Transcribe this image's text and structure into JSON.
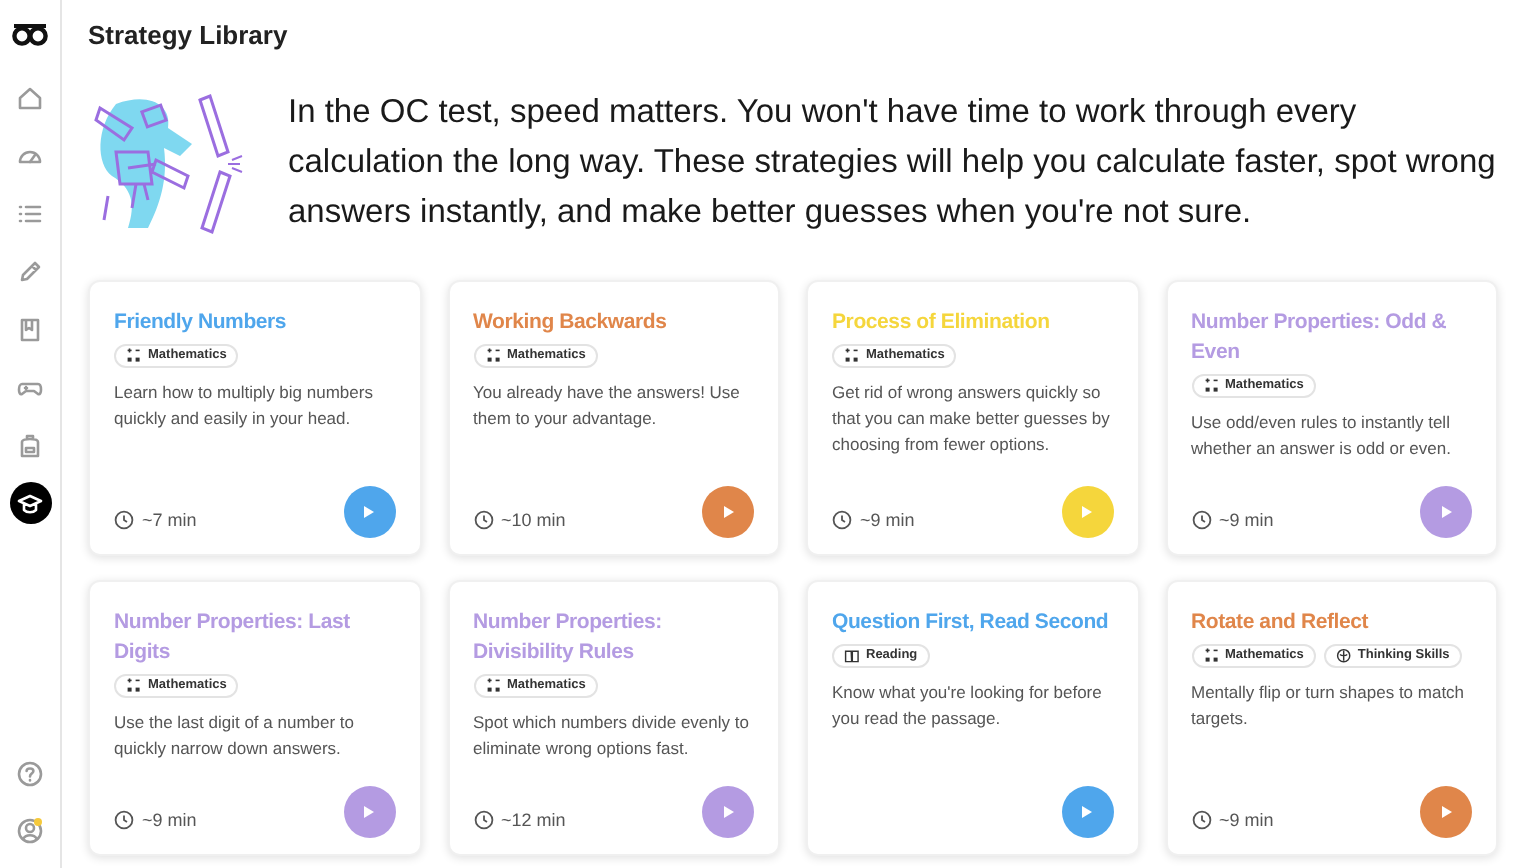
{
  "header": {
    "title": "Strategy Library"
  },
  "sidebar": {
    "items": [
      {
        "selected": false
      },
      {
        "selected": false
      },
      {
        "selected": false
      },
      {
        "selected": false
      },
      {
        "selected": false
      },
      {
        "selected": false
      },
      {
        "selected": false
      },
      {
        "selected": true
      }
    ]
  },
  "intro": "In the OC test, speed matters. You won't have time to work through every calculation the long way. These strategies will help you calculate faster, spot wrong answers instantly, and make better guesses when you're not sure.",
  "cards": [
    {
      "title": "Friendly Numbers",
      "color": "#4fa6ec",
      "tags": [
        {
          "kind": "math",
          "label": "Mathematics"
        }
      ],
      "description": "Learn how to multiply big numbers quickly and easily in your head.",
      "time": "~7 min"
    },
    {
      "title": "Working Backwards",
      "color": "#e0864a",
      "tags": [
        {
          "kind": "math",
          "label": "Mathematics"
        }
      ],
      "description": "You already have the answers! Use them to your advantage.",
      "time": "~10 min"
    },
    {
      "title": "Process of Elimination",
      "color": "#f5d63c",
      "tags": [
        {
          "kind": "math",
          "label": "Mathematics"
        }
      ],
      "description": "Get rid of wrong answers quickly so that you can make better guesses by choosing from fewer options.",
      "time": "~9 min"
    },
    {
      "title": "Number Properties: Odd & Even",
      "color": "#b49be2",
      "tags": [
        {
          "kind": "math",
          "label": "Mathematics"
        }
      ],
      "description": "Use odd/even rules to instantly tell whether an answer is odd or even.",
      "time": "~9 min"
    },
    {
      "title": "Number Properties: Last Digits",
      "color": "#b49be2",
      "tags": [
        {
          "kind": "math",
          "label": "Mathematics"
        }
      ],
      "description": "Use the last digit of a number to quickly narrow down answers.",
      "time": "~9 min"
    },
    {
      "title": "Number Properties: Divisibility Rules",
      "color": "#b49be2",
      "tags": [
        {
          "kind": "math",
          "label": "Mathematics"
        }
      ],
      "description": "Spot which numbers divide evenly to eliminate wrong options fast.",
      "time": "~12 min"
    },
    {
      "title": "Question First, Read Second",
      "color": "#4fa6ec",
      "tags": [
        {
          "kind": "reading",
          "label": "Reading"
        }
      ],
      "description": "Know what you're looking for before you read the passage."
    },
    {
      "title": "Rotate and Reflect",
      "color": "#e0864a",
      "tags": [
        {
          "kind": "math",
          "label": "Mathematics"
        },
        {
          "kind": "thinking",
          "label": "Thinking Skills"
        }
      ],
      "description": "Mentally flip or turn shapes to match targets.",
      "time": "~9 min"
    }
  ]
}
